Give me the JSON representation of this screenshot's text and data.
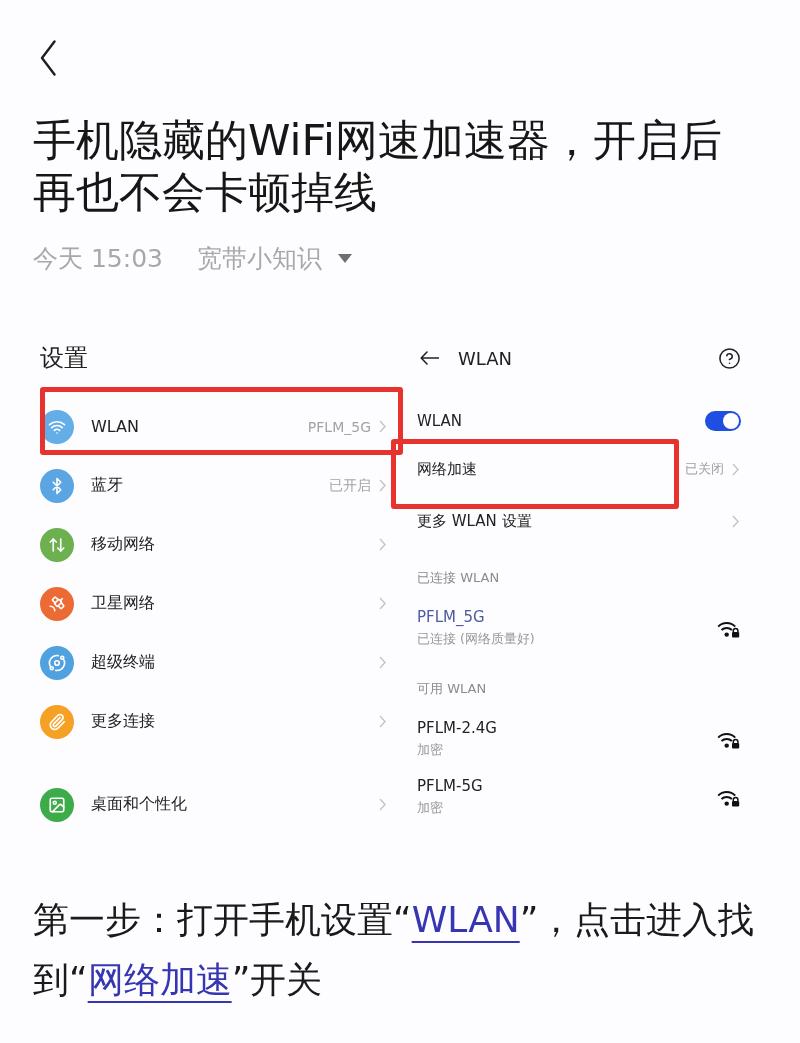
{
  "article": {
    "title": "手机隐藏的WiFi网速加速器，开启后再也不会卡顿掉线",
    "date": "今天 15:03",
    "author": "宽带小知识"
  },
  "screenshot": {
    "settings": {
      "title": "设置",
      "sections": [
        {
          "items": [
            {
              "kind": "wifi",
              "color": "#64aee8",
              "label": "WLAN",
              "value": "PFLM_5G",
              "highlighted": true
            },
            {
              "kind": "bluetooth",
              "color": "#5aa5e2",
              "label": "蓝牙",
              "value": "已开启",
              "highlighted": false
            },
            {
              "kind": "mobile",
              "color": "#6cb04f",
              "label": "移动网络",
              "highlighted": false
            },
            {
              "kind": "satellite",
              "color": "#ec6b35",
              "label": "卫星网络",
              "highlighted": false
            },
            {
              "kind": "terminal",
              "color": "#4fa2df",
              "label": "超级终端",
              "highlighted": false
            },
            {
              "kind": "link",
              "color": "#f4a125",
              "label": "更多连接",
              "highlighted": false
            }
          ]
        },
        {
          "items": [
            {
              "kind": "wallpaper",
              "color": "#3dab4a",
              "label": "桌面和个性化",
              "highlighted": false
            }
          ]
        }
      ]
    },
    "wlan": {
      "title": "WLAN",
      "switch": {
        "label": "WLAN",
        "on": true
      },
      "rows": [
        {
          "label": "网络加速",
          "value": "已关闭",
          "highlighted": true
        },
        {
          "label": "更多 WLAN 设置",
          "highlighted": false
        }
      ],
      "network_groups": [
        {
          "heading": "已连接 WLAN",
          "networks": [
            {
              "name": "PFLM_5G",
              "status": "已连接 (网络质量好)",
              "connected": true
            }
          ]
        },
        {
          "heading": "可用 WLAN",
          "networks": [
            {
              "name": "PFLM-2.4G",
              "status": "加密",
              "connected": false
            },
            {
              "name": "PFLM-5G",
              "status": "加密",
              "connected": false
            }
          ]
        }
      ]
    }
  },
  "caption": [
    {
      "kind": "text",
      "text": "第一步：打开手机设置“"
    },
    {
      "kind": "link",
      "text": "WLAN"
    },
    {
      "kind": "text",
      "text": "”，点击进入找到“"
    },
    {
      "kind": "link",
      "text": "网络加速"
    },
    {
      "kind": "text",
      "text": "”开关"
    }
  ]
}
